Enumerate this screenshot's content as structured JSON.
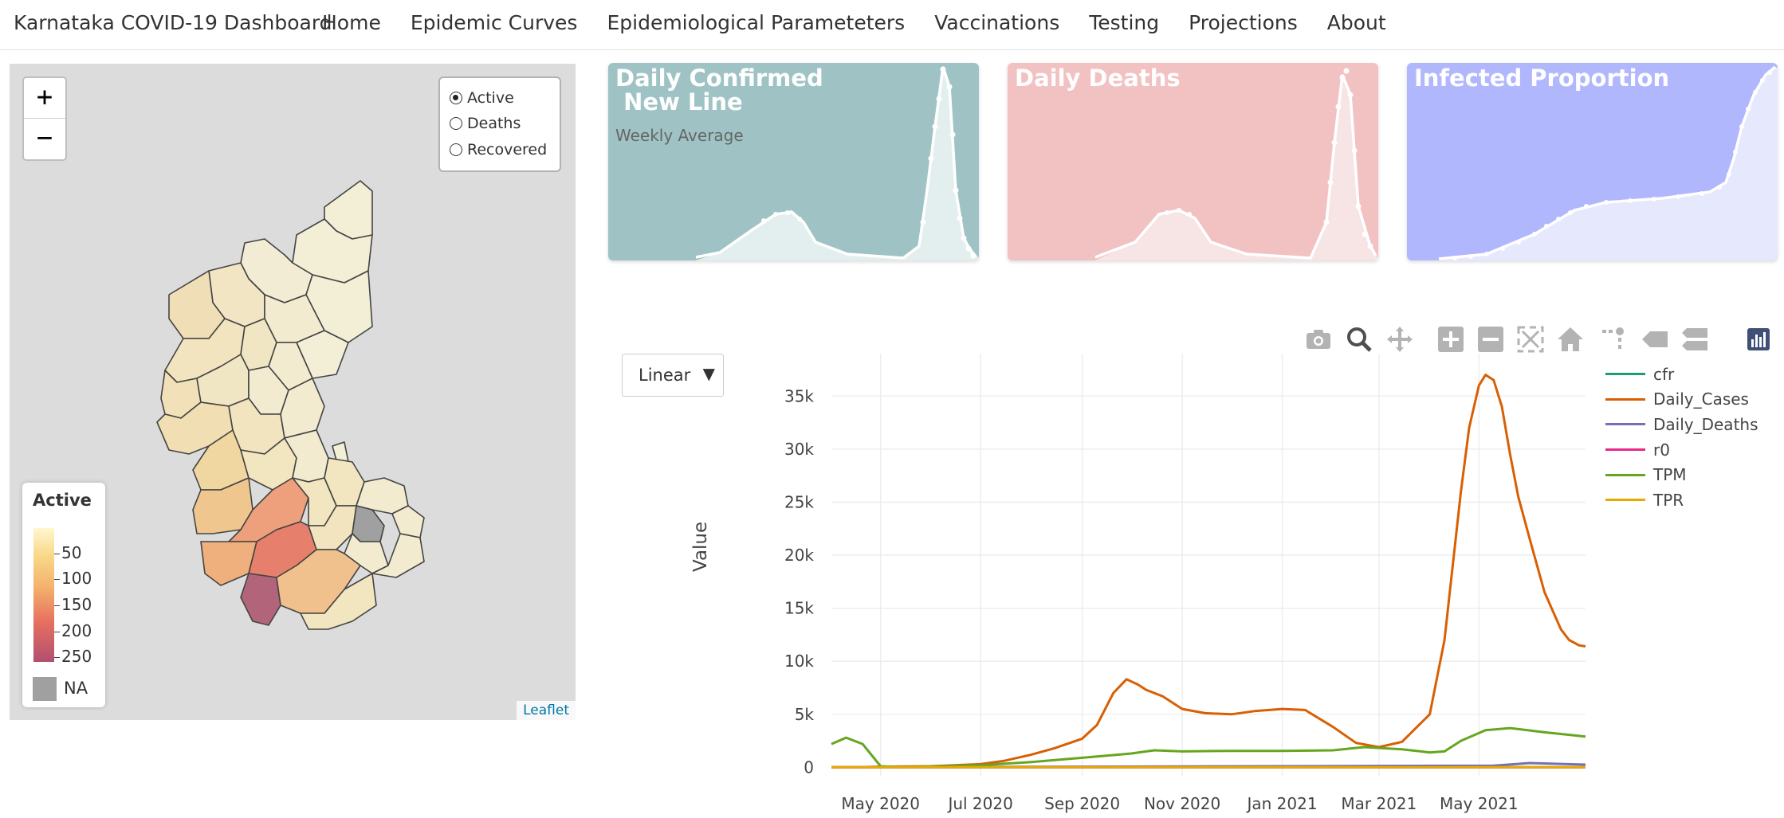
{
  "navbar": {
    "brand": "Karnataka COVID-19 Dashboard",
    "links": [
      "Home",
      "Epidemic Curves",
      "Epidemiological Parameteters",
      "Vaccinations",
      "Testing",
      "Projections",
      "About"
    ]
  },
  "map": {
    "zoom_in": "+",
    "zoom_out": "−",
    "radio_options": [
      "Active",
      "Deaths",
      "Recovered"
    ],
    "radio_selected": "Active",
    "legend": {
      "title": "Active",
      "labels": [
        "50",
        "100",
        "150",
        "200",
        "250"
      ],
      "na_label": "NA"
    },
    "attribution": "Leaflet"
  },
  "cards": [
    {
      "title": "Daily Confirmed\n New Line",
      "subtitle": "Weekly Average",
      "color": "#9fc3c4"
    },
    {
      "title": "Daily Deaths",
      "subtitle": "",
      "color": "#f2c1c2"
    },
    {
      "title": "Infected Proportion",
      "subtitle": "",
      "color": "#b1b7fd"
    }
  ],
  "plot": {
    "scale_selected": "Linear",
    "scale_arrow": "▼",
    "modebar_icons": [
      "camera-icon",
      "zoom-icon",
      "pan-icon",
      "zoom-in-icon",
      "zoom-out-icon",
      "autoscale-icon",
      "home-icon",
      "spike-lines-icon",
      "hover-closest-icon",
      "hover-compare-icon",
      "plotly-logo-icon"
    ]
  },
  "chart_data": {
    "type": "line",
    "title": "",
    "xlabel": "",
    "ylabel": "Value",
    "x_ticks": [
      "May 2020",
      "Jul 2020",
      "Sep 2020",
      "Nov 2020",
      "Jan 2021",
      "Mar 2021",
      "May 2021"
    ],
    "y_ticks": [
      "0",
      "5k",
      "10k",
      "15k",
      "20k",
      "25k",
      "30k",
      "35k"
    ],
    "ylim": [
      -800,
      39000
    ],
    "x_range": [
      "2020-04-01",
      "2021-07-05"
    ],
    "grid": true,
    "legend_position": "top-right",
    "series": [
      {
        "name": "cfr",
        "color": "#1b9e77",
        "x": [
          "2020-04-01",
          "2021-07-05"
        ],
        "y": [
          0,
          0
        ]
      },
      {
        "name": "Daily_Cases",
        "color": "#d95f02",
        "x": [
          "2020-04-01",
          "2020-04-20",
          "2020-05-01",
          "2020-06-01",
          "2020-07-01",
          "2020-07-15",
          "2020-08-01",
          "2020-08-15",
          "2020-09-01",
          "2020-09-10",
          "2020-09-20",
          "2020-09-28",
          "2020-10-05",
          "2020-10-10",
          "2020-10-20",
          "2020-11-01",
          "2020-11-15",
          "2020-12-01",
          "2020-12-15",
          "2021-01-01",
          "2021-01-15",
          "2021-02-01",
          "2021-02-15",
          "2021-03-01",
          "2021-03-15",
          "2021-04-01",
          "2021-04-10",
          "2021-04-20",
          "2021-04-25",
          "2021-05-01",
          "2021-05-05",
          "2021-05-10",
          "2021-05-15",
          "2021-05-20",
          "2021-05-25",
          "2021-06-01",
          "2021-06-10",
          "2021-06-20",
          "2021-06-25",
          "2021-07-01",
          "2021-07-05"
        ],
        "y": [
          0,
          20,
          60,
          100,
          300,
          600,
          1200,
          1800,
          2700,
          4000,
          7000,
          8300,
          7800,
          7300,
          6700,
          5500,
          5100,
          5000,
          5300,
          5500,
          5400,
          3800,
          2300,
          1900,
          2400,
          5000,
          12000,
          26000,
          32000,
          36000,
          37000,
          36500,
          34000,
          29500,
          25500,
          21500,
          16500,
          13000,
          12000,
          11500,
          11400
        ]
      },
      {
        "name": "Daily_Deaths",
        "color": "#7570b3",
        "x": [
          "2020-04-01",
          "2021-05-10",
          "2021-06-01",
          "2021-07-05"
        ],
        "y": [
          0,
          150,
          400,
          250
        ]
      },
      {
        "name": "r0",
        "color": "#e7298a",
        "x": [
          "2020-04-01",
          "2021-07-05"
        ],
        "y": [
          0,
          0
        ]
      },
      {
        "name": "TPM",
        "color": "#66a61e",
        "x": [
          "2020-04-01",
          "2020-04-10",
          "2020-04-20",
          "2020-05-01",
          "2020-05-15",
          "2020-07-01",
          "2020-08-01",
          "2020-09-01",
          "2020-10-01",
          "2020-10-15",
          "2020-11-01",
          "2020-12-01",
          "2021-01-01",
          "2021-02-01",
          "2021-02-20",
          "2021-03-15",
          "2021-04-01",
          "2021-04-10",
          "2021-04-20",
          "2021-05-05",
          "2021-05-20",
          "2021-06-10",
          "2021-07-05"
        ],
        "y": [
          2200,
          2800,
          2200,
          100,
          0,
          200,
          500,
          900,
          1300,
          1600,
          1500,
          1550,
          1550,
          1600,
          1900,
          1700,
          1400,
          1500,
          2500,
          3500,
          3700,
          3300,
          2900
        ]
      },
      {
        "name": "TPR",
        "color": "#e6ab02",
        "x": [
          "2020-04-01",
          "2021-07-05"
        ],
        "y": [
          0,
          0
        ]
      }
    ]
  }
}
